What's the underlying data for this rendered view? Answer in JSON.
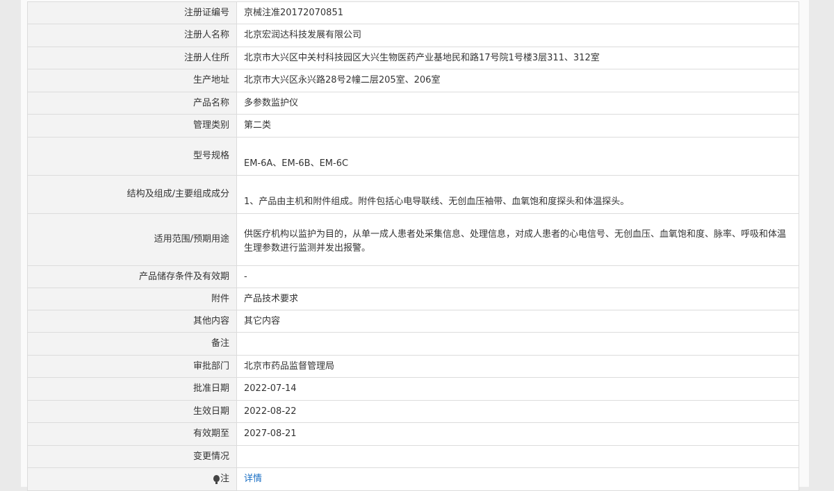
{
  "rows": [
    {
      "label": "注册证编号",
      "value": "京械注准20172070851"
    },
    {
      "label": "注册人名称",
      "value": "北京宏润达科技发展有限公司"
    },
    {
      "label": "注册人住所",
      "value": "北京市大兴区中关村科技园区大兴生物医药产业基地民和路17号院1号楼3层311、312室"
    },
    {
      "label": "生产地址",
      "value": "北京市大兴区永兴路28号2幢二层205室、206室"
    },
    {
      "label": "产品名称",
      "value": "多参数监护仪"
    },
    {
      "label": "管理类别",
      "value": "第二类"
    },
    {
      "label": "型号规格",
      "value": "EM-6A、EM-6B、EM-6C"
    },
    {
      "label": "结构及组成/主要组成成分",
      "value": "1、产品由主机和附件组成。附件包括心电导联线、无创血压袖带、血氧饱和度探头和体温探头。"
    },
    {
      "label": "适用范围/预期用途",
      "value": "供医疗机构以监护为目的，从单一成人患者处采集信息、处理信息，对成人患者的心电信号、无创血压、血氧饱和度、脉率、呼吸和体温生理参数进行监测并发出报警。"
    },
    {
      "label": "产品储存条件及有效期",
      "value": "-"
    },
    {
      "label": "附件",
      "value": "产品技术要求"
    },
    {
      "label": "其他内容",
      "value": "其它内容"
    },
    {
      "label": "备注",
      "value": ""
    },
    {
      "label": "审批部门",
      "value": "北京市药品监督管理局"
    },
    {
      "label": "批准日期",
      "value": "2022-07-14"
    },
    {
      "label": "生效日期",
      "value": "2022-08-22"
    },
    {
      "label": "有效期至",
      "value": "2027-08-21"
    },
    {
      "label": "变更情况",
      "value": ""
    },
    {
      "label": "注",
      "value": "详情"
    }
  ]
}
